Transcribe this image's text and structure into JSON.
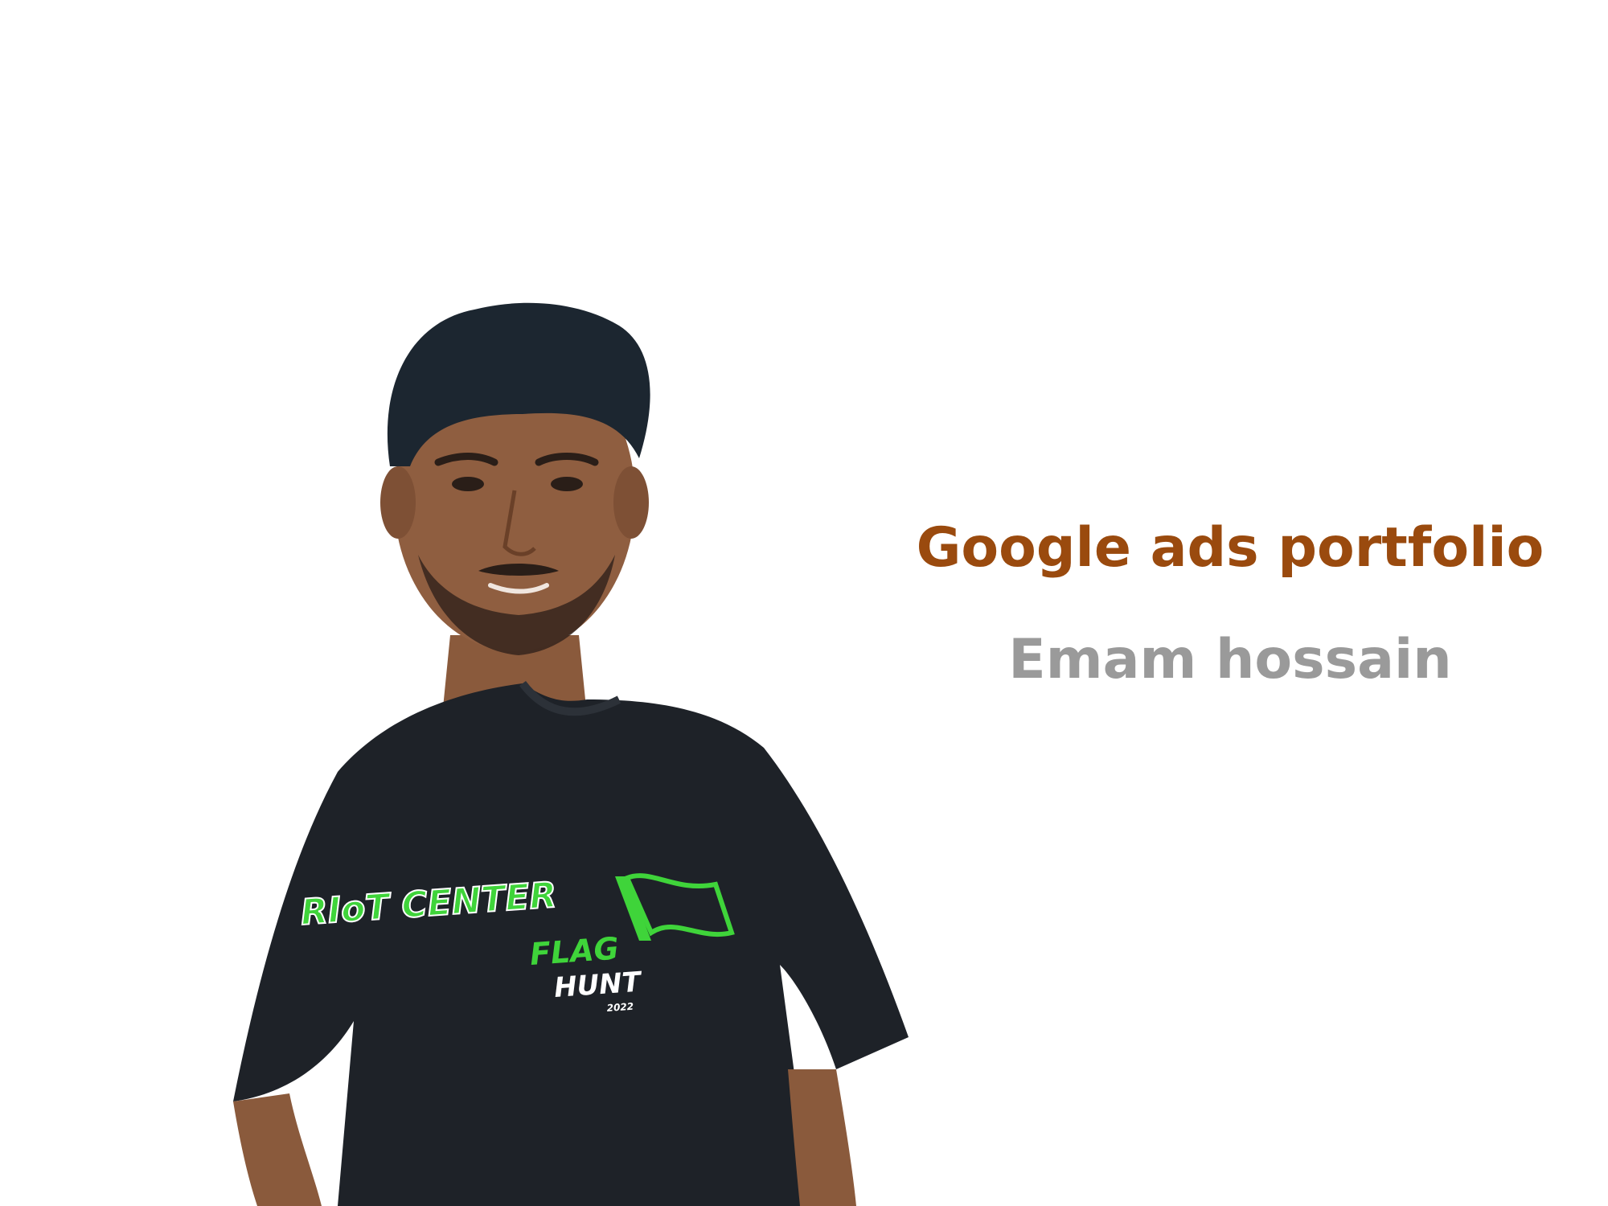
{
  "slide": {
    "title": "Google ads portfolio",
    "subtitle": "Emam hossain"
  },
  "portrait": {
    "shirt_print_line1": "RIoT CENTER",
    "shirt_print_line2": "FLAG",
    "shirt_print_line3": "HUNT",
    "shirt_print_year": "2022"
  },
  "colors": {
    "background": "#ffffff",
    "title": "#9a4a0e",
    "subtitle": "#9a9a9a",
    "shirt": "#1e2228",
    "print_green": "#3fd43a"
  }
}
